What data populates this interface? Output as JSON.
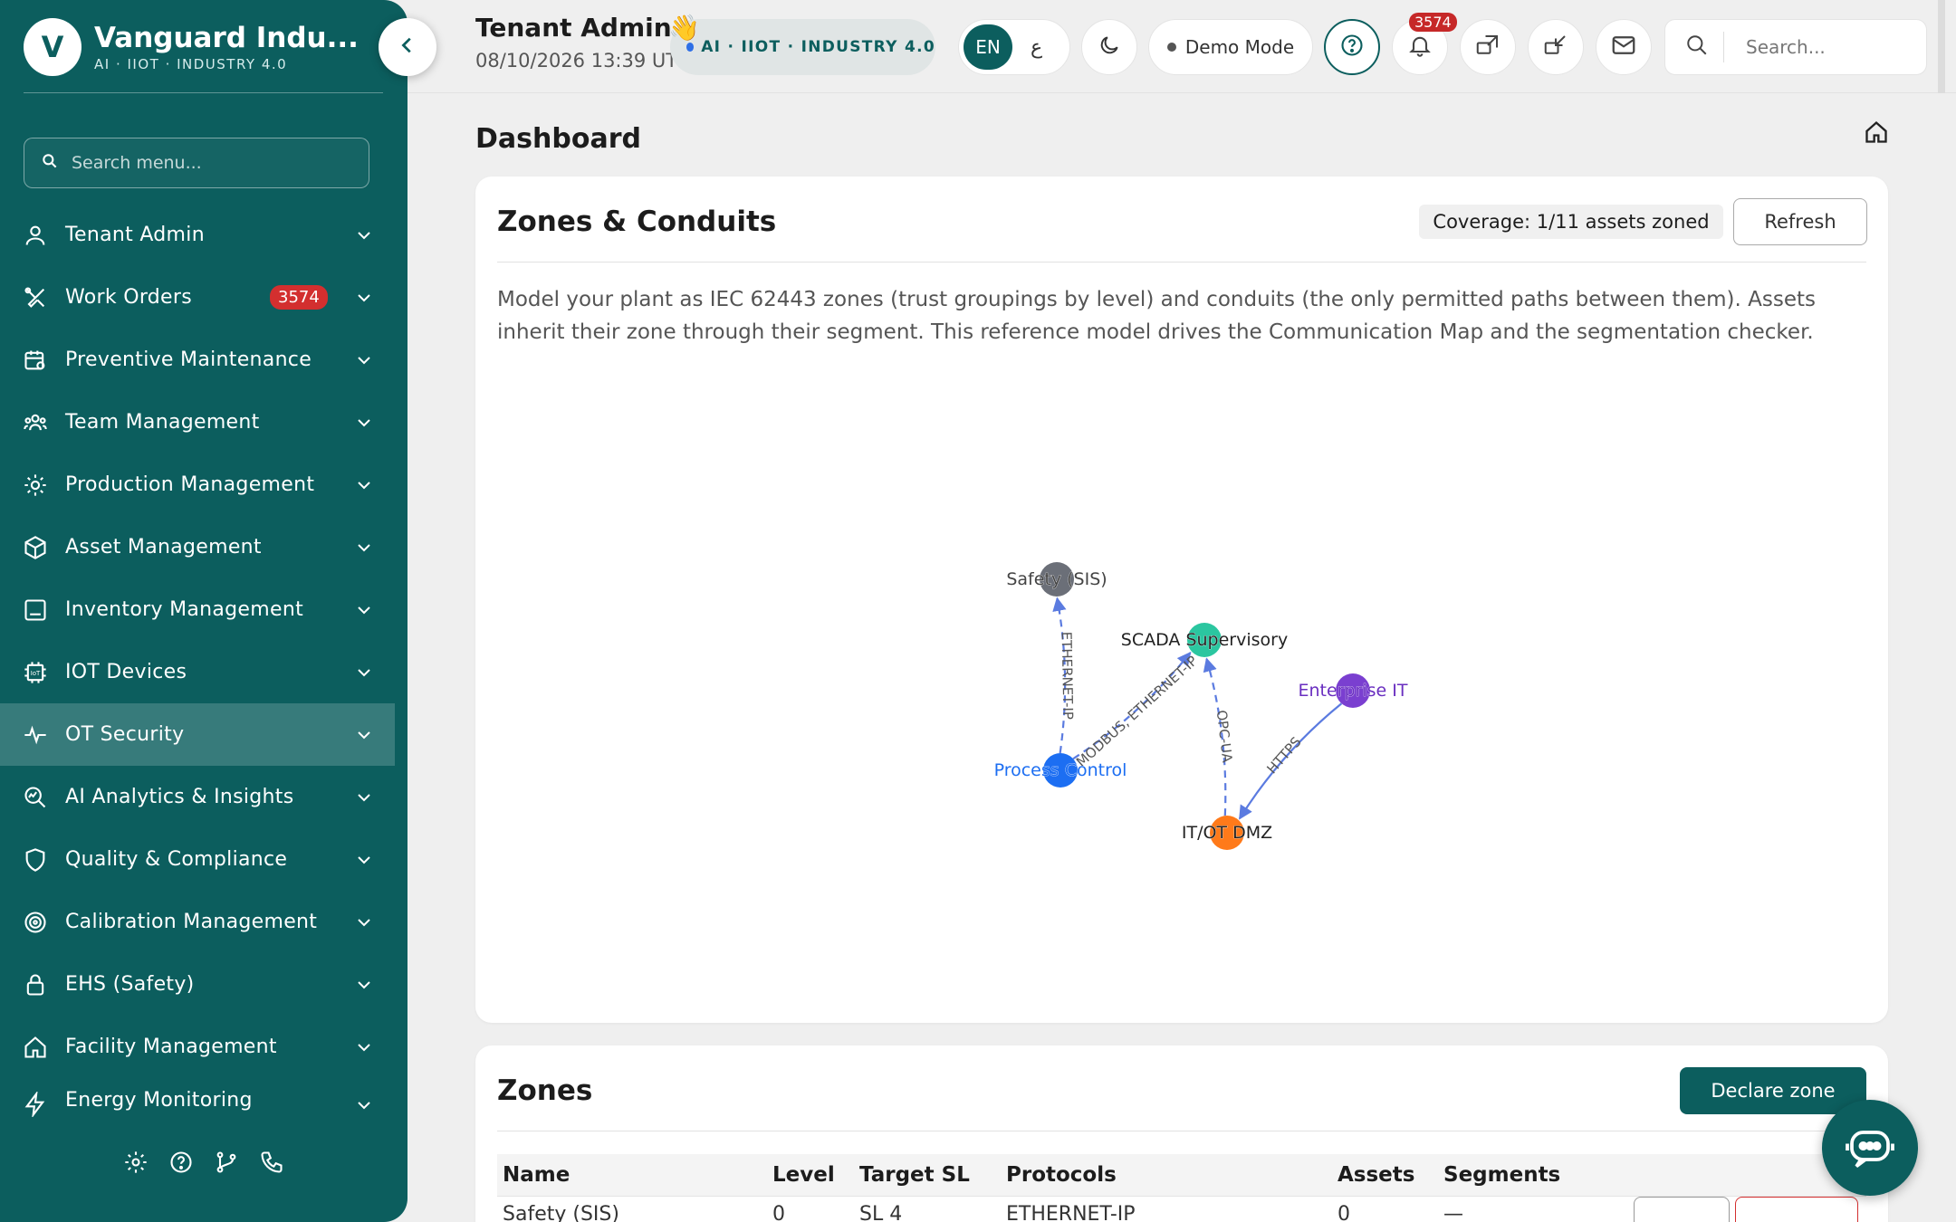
{
  "brand": {
    "logo_letter": "V",
    "name": "Vanguard Indu...",
    "tagline": "AI · IIOT · INDUSTRY 4.0"
  },
  "sidebar": {
    "search_placeholder": "Search menu...",
    "items": [
      {
        "label": "Tenant Admin",
        "icon": "user-icon"
      },
      {
        "label": "Work Orders",
        "icon": "wrench-screwdriver-icon",
        "badge": "3574"
      },
      {
        "label": "Preventive Maintenance",
        "icon": "calendar-gear-icon"
      },
      {
        "label": "Team Management",
        "icon": "team-icon"
      },
      {
        "label": "Production Management",
        "icon": "gear-icon"
      },
      {
        "label": "Asset Management",
        "icon": "cube-icon"
      },
      {
        "label": "Inventory Management",
        "icon": "box-icon"
      },
      {
        "label": "IOT Devices",
        "icon": "iot-chip-icon"
      },
      {
        "label": "OT Security",
        "icon": "pulse-icon",
        "active": true
      },
      {
        "label": "AI Analytics & Insights",
        "icon": "analytics-search-icon"
      },
      {
        "label": "Quality & Compliance",
        "icon": "shield-icon"
      },
      {
        "label": "Calibration Management",
        "icon": "target-icon"
      },
      {
        "label": "EHS (Safety)",
        "icon": "lock-icon"
      },
      {
        "label": "Facility Management",
        "icon": "home-icon"
      },
      {
        "label": "Energy Monitoring",
        "icon": "bolt-icon"
      }
    ],
    "footer_icons": [
      "settings-icon",
      "help-icon",
      "git-branch-icon",
      "phone-icon"
    ]
  },
  "topbar": {
    "title": "Tenant Admin",
    "timestamp": "08/10/2026 13:39 UTC",
    "wave": "👋",
    "ai_pill": "AI · IIOT · INDUSTRY 4.0",
    "lang_en": "EN",
    "lang_ar": "ع",
    "demo_mode": "Demo Mode",
    "notification_count": "3574",
    "search_placeholder": "Search..."
  },
  "page": {
    "heading": "Dashboard"
  },
  "zones_card": {
    "title": "Zones & Conduits",
    "coverage": "Coverage: 1/11 assets zoned",
    "refresh_label": "Refresh",
    "description": "Model your plant as IEC 62443 zones (trust groupings by level) and conduits (the only permitted paths between them). Assets inherit their zone through their segment. This reference model drives the Communication Map and the segmentation checker."
  },
  "graph": {
    "nodes": [
      {
        "id": "sis",
        "label": "Safety (SIS)",
        "color": "#6b6f78",
        "label_color": "#444"
      },
      {
        "id": "scada",
        "label": "SCADA Supervisory",
        "color": "#2bc6a0",
        "label_color": "#222"
      },
      {
        "id": "ent",
        "label": "Enterprise IT",
        "color": "#7a3fd0",
        "label_color": "#6a2fc0"
      },
      {
        "id": "pc",
        "label": "Process Control",
        "color": "#1c6ef2",
        "label_color": "#1c6ef2"
      },
      {
        "id": "dmz",
        "label": "IT/OT DMZ",
        "color": "#ff7a1a",
        "label_color": "#222"
      }
    ],
    "edges": [
      {
        "from": "pc",
        "to": "sis",
        "label": "ETHERNET-IP",
        "style": "dashed"
      },
      {
        "from": "pc",
        "to": "scada",
        "label": "MODBUS, ETHERNET-IP",
        "style": "dashed"
      },
      {
        "from": "dmz",
        "to": "scada",
        "label": "OPC-UA",
        "style": "dashed"
      },
      {
        "from": "ent",
        "to": "dmz",
        "label": "HTTPS",
        "style": "solid"
      }
    ]
  },
  "zones_table_card": {
    "title": "Zones",
    "declare_label": "Declare zone",
    "columns": [
      "Name",
      "Level",
      "Target SL",
      "Protocols",
      "Assets",
      "Segments"
    ],
    "rows": [
      [
        "Safety (SIS)",
        "0",
        "SL 4",
        "ETHERNET-IP",
        "0",
        "—"
      ]
    ]
  },
  "colors": {
    "sidebar_bg": "#0c5e5e",
    "accent": "#0c5e5e",
    "badge_red": "#d32f2f"
  }
}
